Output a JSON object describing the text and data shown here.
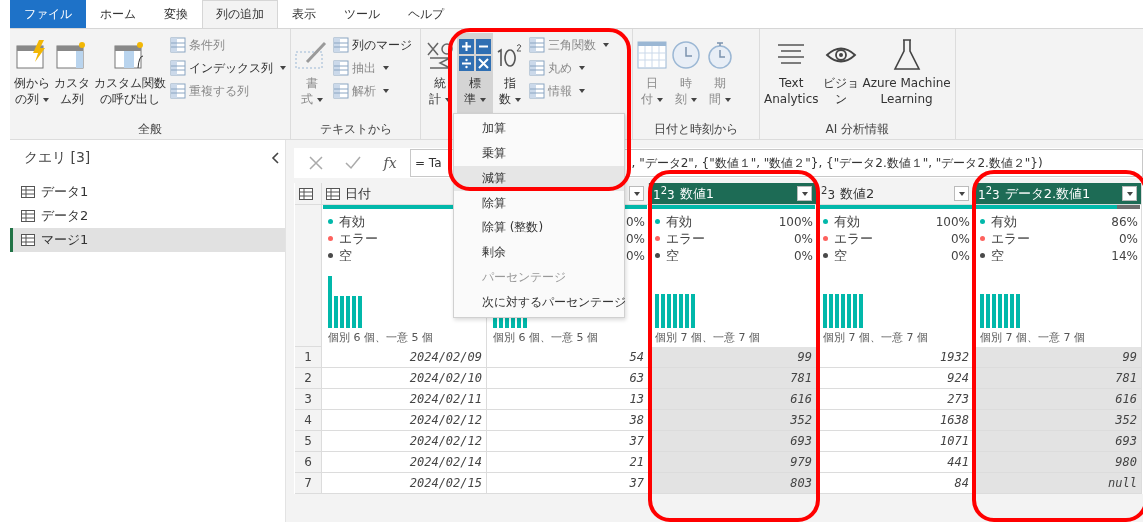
{
  "tabs": [
    {
      "label": "ファイル",
      "kind": "file",
      "selected": false
    },
    {
      "label": "ホーム",
      "kind": "tab",
      "selected": false
    },
    {
      "label": "変換",
      "kind": "tab",
      "selected": false
    },
    {
      "label": "列の追加",
      "kind": "tab",
      "selected": true
    },
    {
      "label": "表示",
      "kind": "tab",
      "selected": false
    },
    {
      "label": "ツール",
      "kind": "tab",
      "selected": false
    },
    {
      "label": "ヘルプ",
      "kind": "tab",
      "selected": false
    }
  ],
  "ribbon": {
    "groups": [
      {
        "label": "全般",
        "large": [
          {
            "lines": [
              "例から",
              "の列"
            ],
            "dropdown": true,
            "disabled": false,
            "selected": false
          },
          {
            "lines": [
              "カスタ",
              "ム列"
            ],
            "dropdown": false,
            "disabled": false,
            "selected": false
          },
          {
            "lines": [
              "カスタム関数",
              "の呼び出し"
            ],
            "dropdown": false,
            "disabled": false,
            "selected": false
          }
        ],
        "small": [
          {
            "label": "条件列",
            "dropdown": false,
            "disabled": true
          },
          {
            "label": "インデックス列",
            "dropdown": true,
            "disabled": false
          },
          {
            "label": "重複する列",
            "dropdown": false,
            "disabled": true
          }
        ]
      },
      {
        "label": "テキストから",
        "large": [
          {
            "lines": [
              "書",
              "式"
            ],
            "dropdown": true,
            "disabled": true,
            "selected": false
          }
        ],
        "small": [
          {
            "label": "列のマージ",
            "dropdown": false,
            "disabled": false
          },
          {
            "label": "抽出",
            "dropdown": true,
            "disabled": true
          },
          {
            "label": "解析",
            "dropdown": true,
            "disabled": true
          }
        ]
      },
      {
        "large": [
          {
            "lines": [
              "統",
              "計"
            ],
            "dropdown": true,
            "disabled": false,
            "selected": false
          },
          {
            "lines": [
              "標",
              "準"
            ],
            "dropdown": true,
            "disabled": false,
            "selected": true
          },
          {
            "lines": [
              "指",
              "数"
            ],
            "dropdown": true,
            "disabled": false,
            "selected": false
          }
        ],
        "small": [
          {
            "label": "三角関数",
            "dropdown": true,
            "disabled": true
          },
          {
            "label": "丸め",
            "dropdown": true,
            "disabled": true
          },
          {
            "label": "情報",
            "dropdown": true,
            "disabled": true
          }
        ]
      },
      {
        "label": "日付と時刻から",
        "large": [
          {
            "lines": [
              "日",
              "付"
            ],
            "dropdown": true,
            "disabled": true,
            "selected": false
          },
          {
            "lines": [
              "時",
              "刻"
            ],
            "dropdown": true,
            "disabled": true,
            "selected": false
          },
          {
            "lines": [
              "期",
              "間"
            ],
            "dropdown": true,
            "disabled": true,
            "selected": false
          }
        ]
      },
      {
        "label": "AI 分析情報",
        "large": [
          {
            "lines": [
              "Text",
              "Analytics"
            ],
            "dropdown": false,
            "disabled": false,
            "selected": false
          },
          {
            "lines": [
              "ビジョ",
              "ン"
            ],
            "dropdown": false,
            "disabled": false,
            "selected": false
          },
          {
            "lines": [
              "Azure Machine",
              "Learning"
            ],
            "dropdown": false,
            "disabled": false,
            "selected": false
          }
        ]
      }
    ]
  },
  "menu": {
    "items": [
      {
        "label": "加算",
        "highlighted": false,
        "disabled": false
      },
      {
        "label": "乗算",
        "highlighted": false,
        "disabled": false
      },
      {
        "label": "減算",
        "highlighted": true,
        "disabled": false
      },
      {
        "label": "除算",
        "highlighted": false,
        "disabled": false
      },
      {
        "label": "除算 (整数)",
        "highlighted": false,
        "disabled": false
      },
      {
        "label": "剰余",
        "highlighted": false,
        "disabled": false
      },
      {
        "label": "パーセンテージ",
        "highlighted": false,
        "disabled": true
      },
      {
        "label": "次に対するパーセンテージ",
        "highlighted": false,
        "disabled": false
      }
    ]
  },
  "sidebar": {
    "title": "クエリ [3]",
    "items": [
      {
        "label": "データ1",
        "selected": false
      },
      {
        "label": "データ2",
        "selected": false
      },
      {
        "label": "マージ1",
        "selected": true
      }
    ]
  },
  "formula": {
    "fx_label": "fx",
    "text_start": "= Ta",
    "text_end": ", \"データ2\", {\"数値１\", \"数値２\"}, {\"データ2.数値１\", \"データ2.数値２\"})"
  },
  "table": {
    "columns": [
      {
        "kind": "date",
        "name": "日付",
        "selected": false,
        "filter_button": false,
        "level": 1,
        "histogram": {
          "kind": "peak"
        },
        "summary": "個別 6 個、一意 5 個",
        "stats": [
          {
            "label": "有効",
            "color": "#01b8aa"
          },
          {
            "label": "エラー",
            "color": "#fd625e"
          },
          {
            "label": "空",
            "color": "#4a4a4a"
          }
        ]
      },
      {
        "kind": "number",
        "selected": false,
        "filter_button": true,
        "level": 1,
        "histogram": {
          "kind": "peak"
        },
        "summary": "個別 6 個、一意 5 個",
        "stats": [
          {
            "value": "0%"
          },
          {
            "value": "0%"
          },
          {
            "value": "0%"
          }
        ]
      },
      {
        "kind": "number",
        "type_label": "1$^{2}$3",
        "name": "数値1",
        "selected": true,
        "filter_button": true,
        "level": 1,
        "histogram": {
          "kind": "even"
        },
        "summary": "個別 7 個、一意 7 個",
        "stats": [
          {
            "label": "有効",
            "color": "#01b8aa",
            "value": "100%"
          },
          {
            "label": "エラー",
            "color": "#fd625e",
            "value": "0%"
          },
          {
            "label": "空",
            "color": "#4a4a4a",
            "value": "0%"
          }
        ]
      },
      {
        "kind": "number",
        "type_label": "$^{2}$3",
        "name": "数値2",
        "selected": false,
        "filter_button": true,
        "level": 1,
        "histogram": {
          "kind": "even"
        },
        "summary": "個別 7 個、一意 7 個",
        "stats": [
          {
            "label": "有効",
            "color": "#01b8aa",
            "value": "100%"
          },
          {
            "label": "エラー",
            "color": "#fd625e",
            "value": "0%"
          },
          {
            "label": "空",
            "color": "#4a4a4a",
            "value": "0%"
          }
        ]
      },
      {
        "kind": "number",
        "type_label": "1$^{2}$3",
        "name": "データ2.数値1",
        "selected": true,
        "filter_button": true,
        "level": 0.86,
        "histogram": {
          "kind": "even"
        },
        "summary": "個別 7 個、一意 7 個",
        "stats": [
          {
            "label": "有効",
            "color": "#01b8aa",
            "value": "86%"
          },
          {
            "label": "エラー",
            "color": "#fd625e",
            "value": "0%"
          },
          {
            "label": "空",
            "color": "#4a4a4a",
            "value": "14%"
          }
        ]
      }
    ],
    "rows": [
      {
        "number": "1",
        "cells": [
          "2024/02/09",
          "54",
          "99",
          "1932",
          "99"
        ]
      },
      {
        "number": "2",
        "cells": [
          "2024/02/10",
          "63",
          "781",
          "924",
          "781"
        ]
      },
      {
        "number": "3",
        "cells": [
          "2024/02/11",
          "13",
          "616",
          "273",
          "616"
        ]
      },
      {
        "number": "4",
        "cells": [
          "2024/02/12",
          "38",
          "352",
          "1638",
          "352"
        ]
      },
      {
        "number": "5",
        "cells": [
          "2024/02/12",
          "37",
          "693",
          "1071",
          "693"
        ]
      },
      {
        "number": "6",
        "cells": [
          "2024/02/14",
          "21",
          "979",
          "441",
          "980"
        ]
      },
      {
        "number": "7",
        "cells": [
          "2024/02/15",
          "37",
          "803",
          "84",
          "null"
        ]
      }
    ]
  }
}
